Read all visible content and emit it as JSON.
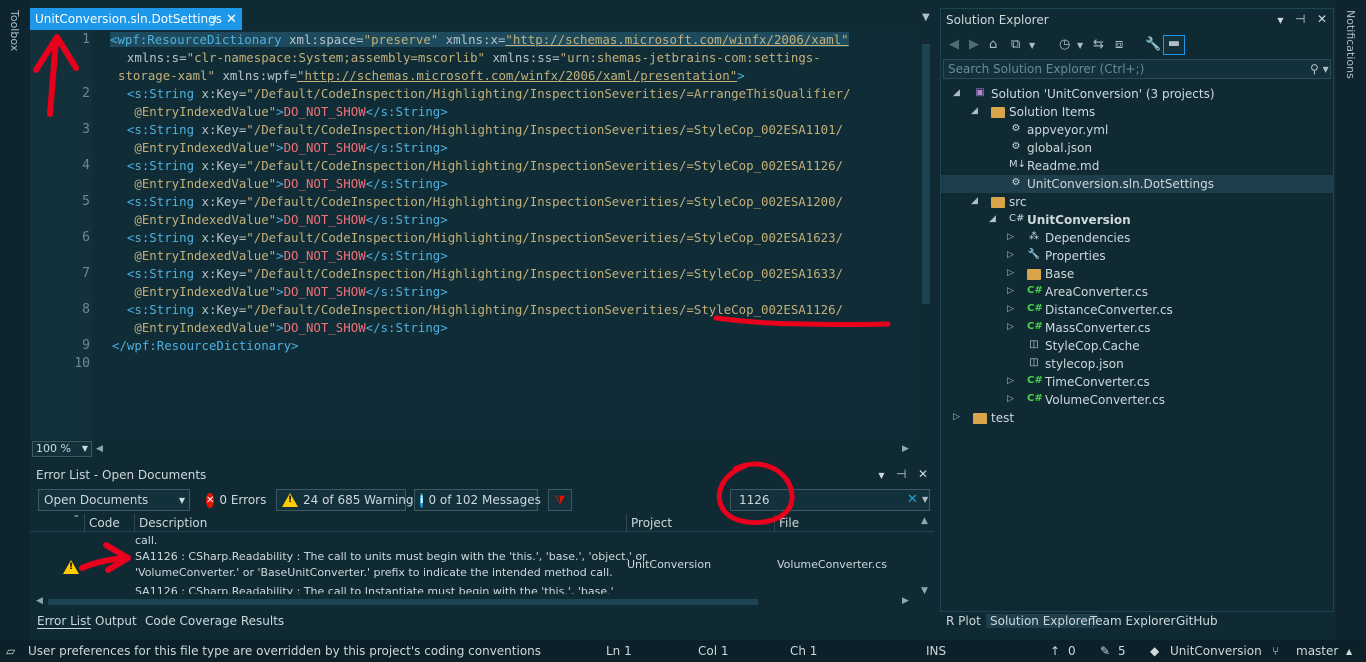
{
  "strips": {
    "toolbox": "Toolbox",
    "notifications": "Notifications"
  },
  "editor": {
    "tab_title": "UnitConversion.sln.DotSettings",
    "zoom": "100 %",
    "line_numbers": [
      "1",
      "2",
      "3",
      "4",
      "5",
      "6",
      "7",
      "8",
      "9",
      "10"
    ],
    "lines": [
      {
        "parts": [
          [
            "tag",
            "<wpf:ResourceDictionary"
          ],
          [
            "attr",
            " xml:space="
          ],
          [
            "str",
            "\"preserve\""
          ],
          [
            "attr",
            " xmlns:x="
          ],
          [
            "url",
            "\"http://schemas.microsoft.com/winfx/2006/xaml\""
          ]
        ]
      },
      {
        "parts": [
          [
            "attr",
            "  xmlns:s="
          ],
          [
            "str",
            "\"clr-namespace:System;assembly=mscorlib\""
          ],
          [
            "attr",
            " xmlns:ss="
          ],
          [
            "str",
            "\"urn:shemas-jetbrains-com:settings-"
          ]
        ]
      },
      {
        "parts": [
          [
            "str",
            "storage-xaml\""
          ],
          [
            "attr",
            " xmlns:wpf="
          ],
          [
            "url",
            "\"http://schemas.microsoft.com/winfx/2006/xaml/presentation\""
          ],
          [
            "tag",
            ">"
          ]
        ]
      },
      {
        "parts": [
          [
            "tag",
            "  <s:String"
          ],
          [
            "attr",
            " x:Key="
          ],
          [
            "str",
            "\"/Default/CodeInspection/Highlighting/InspectionSeverities/=ArrangeThisQualifier/"
          ]
        ]
      },
      {
        "parts": [
          [
            "str",
            "   @EntryIndexedValue\""
          ],
          [
            "tag",
            ">"
          ],
          [
            "kw",
            "DO_NOT_SHOW"
          ],
          [
            "tag",
            "</s:String>"
          ]
        ]
      },
      {
        "parts": [
          [
            "tag",
            "  <s:String"
          ],
          [
            "attr",
            " x:Key="
          ],
          [
            "str",
            "\"/Default/CodeInspection/Highlighting/InspectionSeverities/=StyleCop_002ESA1101/"
          ]
        ]
      },
      {
        "parts": [
          [
            "str",
            "   @EntryIndexedValue\""
          ],
          [
            "tag",
            ">"
          ],
          [
            "kw",
            "DO_NOT_SHOW"
          ],
          [
            "tag",
            "</s:String>"
          ]
        ]
      },
      {
        "parts": [
          [
            "tag",
            "  <s:String"
          ],
          [
            "attr",
            " x:Key="
          ],
          [
            "str",
            "\"/Default/CodeInspection/Highlighting/InspectionSeverities/=StyleCop_002ESA1126/"
          ]
        ]
      },
      {
        "parts": [
          [
            "str",
            "   @EntryIndexedValue\""
          ],
          [
            "tag",
            ">"
          ],
          [
            "kw",
            "DO_NOT_SHOW"
          ],
          [
            "tag",
            "</s:String>"
          ]
        ]
      },
      {
        "parts": [
          [
            "tag",
            "  <s:String"
          ],
          [
            "attr",
            " x:Key="
          ],
          [
            "str",
            "\"/Default/CodeInspection/Highlighting/InspectionSeverities/=StyleCop_002ESA1200/"
          ]
        ]
      },
      {
        "parts": [
          [
            "str",
            "   @EntryIndexedValue\""
          ],
          [
            "tag",
            ">"
          ],
          [
            "kw",
            "DO_NOT_SHOW"
          ],
          [
            "tag",
            "</s:String>"
          ]
        ]
      },
      {
        "parts": [
          [
            "tag",
            "  <s:String"
          ],
          [
            "attr",
            " x:Key="
          ],
          [
            "str",
            "\"/Default/CodeInspection/Highlighting/InspectionSeverities/=StyleCop_002ESA1623/"
          ]
        ]
      },
      {
        "parts": [
          [
            "str",
            "   @EntryIndexedValue\""
          ],
          [
            "tag",
            ">"
          ],
          [
            "kw",
            "DO_NOT_SHOW"
          ],
          [
            "tag",
            "</s:String>"
          ]
        ]
      },
      {
        "parts": [
          [
            "tag",
            "  <s:String"
          ],
          [
            "attr",
            " x:Key="
          ],
          [
            "str",
            "\"/Default/CodeInspection/Highlighting/InspectionSeverities/=StyleCop_002ESA1633/"
          ]
        ]
      },
      {
        "parts": [
          [
            "str",
            "   @EntryIndexedValue\""
          ],
          [
            "tag",
            ">"
          ],
          [
            "kw",
            "DO_NOT_SHOW"
          ],
          [
            "tag",
            "</s:String>"
          ]
        ]
      },
      {
        "parts": [
          [
            "tag",
            "  <s:String"
          ],
          [
            "attr",
            " x:Key="
          ],
          [
            "str",
            "\"/Default/CodeInspection/Highlighting/InspectionSeverities/=StyleCop_002ESA1126/"
          ]
        ]
      },
      {
        "parts": [
          [
            "str",
            "   @EntryIndexedValue\""
          ],
          [
            "tag",
            ">"
          ],
          [
            "kw",
            "DO_NOT_SHOW"
          ],
          [
            "tag",
            "</s:String>"
          ]
        ]
      },
      {
        "parts": [
          [
            "tag",
            "</wpf:ResourceDictionary>"
          ]
        ]
      }
    ]
  },
  "error_list": {
    "title": "Error List - Open Documents",
    "scope": "Open Documents",
    "errors": "0 Errors",
    "warnings": "24 of 685 Warnings",
    "messages": "0 of 102 Messages",
    "search_value": "1126",
    "columns": {
      "code": "Code",
      "description": "Description",
      "project": "Project",
      "file": "File"
    },
    "prev_fragment": "call.",
    "row": {
      "desc_line1": "SA1126 : CSharp.Readability : The call to units must begin with the 'this.', 'base.', 'object.' or",
      "desc_line2": "'VolumeConverter.' or 'BaseUnitConverter.' prefix to indicate the intended method call.",
      "project": "UnitConversion",
      "file": "VolumeConverter.cs"
    },
    "next_fragment": "SA1126 : CSharp.Readability : The call to Instantiate must begin with the 'this.', 'base.'"
  },
  "bottom_tabs": [
    "Error List",
    "Output",
    "Code Coverage Results"
  ],
  "solution_explorer": {
    "title": "Solution Explorer",
    "search_placeholder": "Search Solution Explorer (Ctrl+;)",
    "tree": [
      {
        "label": "Solution 'UnitConversion' (3 projects)",
        "icon": "solution-icon"
      },
      {
        "label": "Solution Items",
        "icon": "folder-icon"
      },
      {
        "label": "appveyor.yml",
        "icon": "config-file-icon"
      },
      {
        "label": "global.json",
        "icon": "config-file-icon"
      },
      {
        "label": "Readme.md",
        "icon": "markdown-icon"
      },
      {
        "label": "UnitConversion.sln.DotSettings",
        "icon": "settings-file-icon"
      },
      {
        "label": "src",
        "icon": "folder-icon"
      },
      {
        "label": "UnitConversion",
        "icon": "csproj-icon"
      },
      {
        "label": "Dependencies",
        "icon": "dependencies-icon"
      },
      {
        "label": "Properties",
        "icon": "wrench-icon"
      },
      {
        "label": "Base",
        "icon": "folder-icon"
      },
      {
        "label": "AreaConverter.cs",
        "icon": "csharp-file-icon"
      },
      {
        "label": "DistanceConverter.cs",
        "icon": "csharp-file-icon"
      },
      {
        "label": "MassConverter.cs",
        "icon": "csharp-file-icon"
      },
      {
        "label": "StyleCop.Cache",
        "icon": "cache-file-icon"
      },
      {
        "label": "stylecop.json",
        "icon": "json-file-icon"
      },
      {
        "label": "TimeConverter.cs",
        "icon": "csharp-file-icon"
      },
      {
        "label": "VolumeConverter.cs",
        "icon": "csharp-file-icon"
      },
      {
        "label": "test",
        "icon": "folder-icon"
      }
    ],
    "bottom_tabs": [
      "R Plot",
      "Solution Explorer",
      "Team Explorer",
      "GitHub"
    ]
  },
  "status_bar": {
    "message": "User preferences for this file type are overridden by this project's coding conventions",
    "ln": "Ln 1",
    "col": "Col 1",
    "ch": "Ch 1",
    "ins": "INS",
    "up_count": "0",
    "pencil_count": "5",
    "repo": "UnitConversion",
    "branch": "master"
  },
  "colors": {
    "accent": "#1c97ea",
    "background": "#0f2a33",
    "annotation": "#e8001c"
  }
}
